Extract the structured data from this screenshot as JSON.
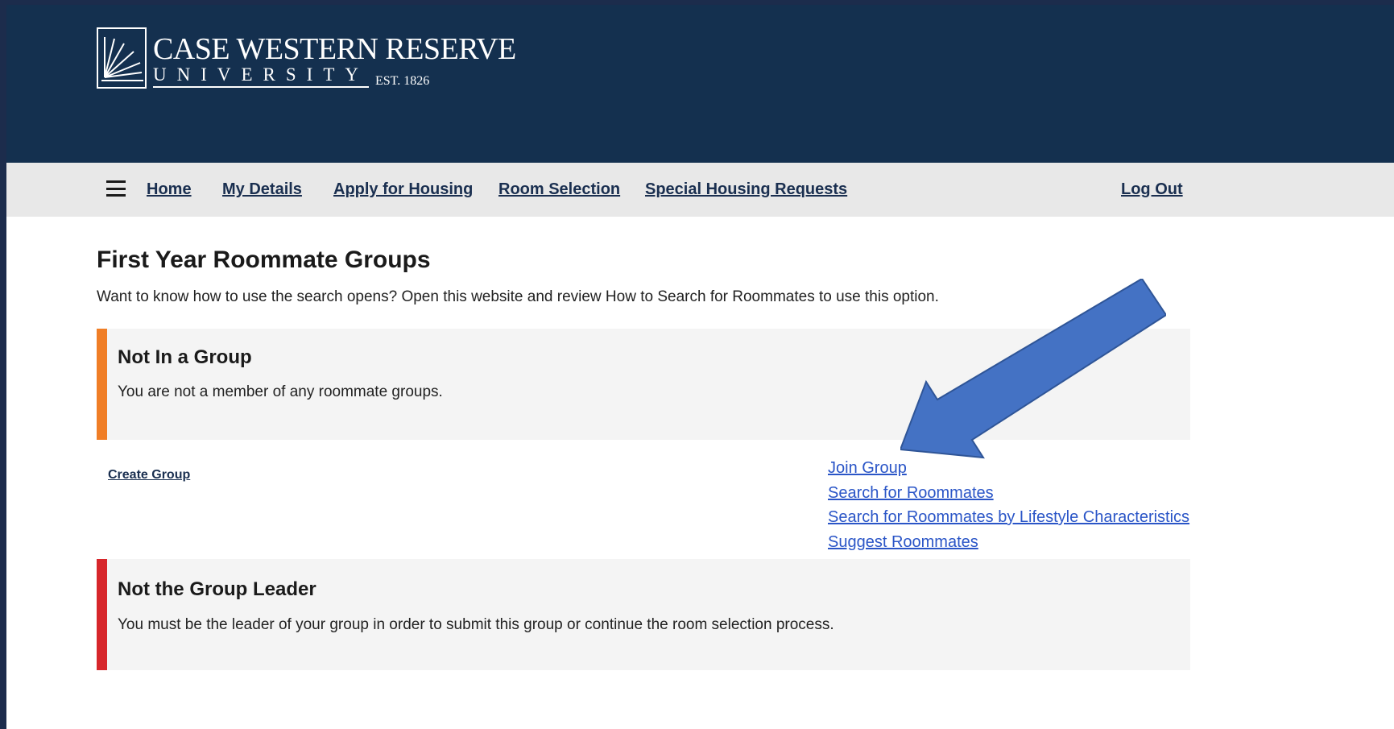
{
  "header": {
    "logo_line1": "CASE WESTERN RESERVE",
    "logo_line2": "UNIVERSITY",
    "logo_est": "EST. 1826"
  },
  "nav": {
    "menu_icon": "hamburger-icon",
    "items": [
      "Home",
      "My Details",
      "Apply for Housing",
      "Room Selection",
      "Special Housing Requests"
    ],
    "logout": "Log Out"
  },
  "page": {
    "title": "First Year Roommate Groups",
    "intro": "Want to know how to use the search opens? Open this website and review How to Search for Roommates to use this option."
  },
  "alerts": {
    "not_in_group": {
      "title": "Not In a Group",
      "text": "You are not a member of any roommate groups.",
      "color": "#f07e26"
    },
    "not_leader": {
      "title": "Not the Group Leader",
      "text": "You must be the leader of your group in order to submit this group or continue the room selection process.",
      "color": "#d7262b"
    }
  },
  "actions": {
    "create_group": "Create Group",
    "links": [
      "Join Group",
      "Search for Roommates",
      "Search for Roommates by Lifestyle Characteristics",
      "Suggest Roommates"
    ]
  },
  "colors": {
    "header_bg": "#14304f",
    "navbar_bg": "#e8e8e8",
    "link_blue": "#2a55c7",
    "annotation_arrow": "#4472c4"
  }
}
